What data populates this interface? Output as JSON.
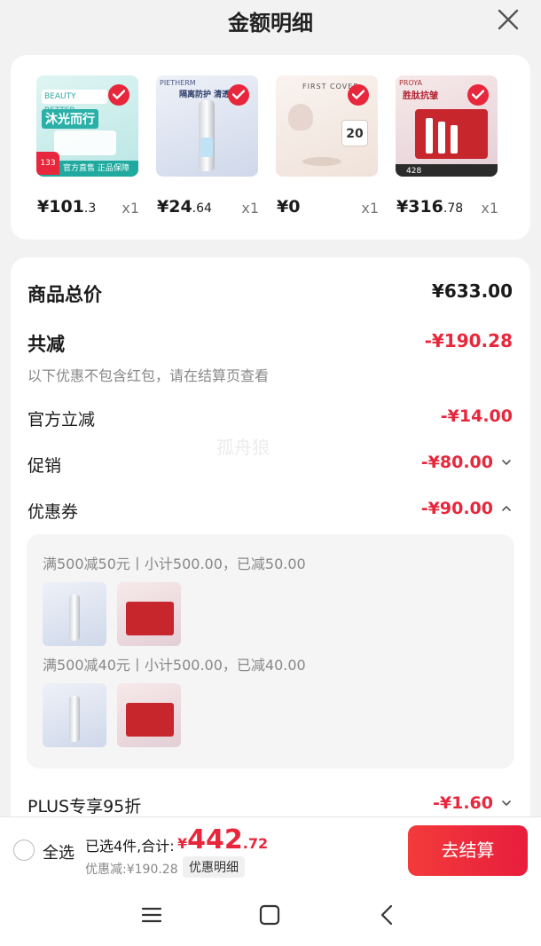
{
  "header": {
    "title": "金额明细",
    "close_icon": "close-icon"
  },
  "products": [
    {
      "price_int": "¥101",
      "price_dec": ".3",
      "qty": "x1",
      "thumb_text": "沐光而行",
      "thumb_brand": "BEAUTY BETTER",
      "thumb_tag": "官方直售 正品保障",
      "thumb_badge": "133",
      "thumb_bg": "#d9f2ef"
    },
    {
      "price_int": "¥24",
      "price_dec": ".64",
      "qty": "x1",
      "thumb_text": "隔离防护 清透底妆",
      "thumb_brand": "PIETHERM",
      "thumb_bg": "#e8ecf6"
    },
    {
      "price_int": "¥0",
      "price_dec": "",
      "qty": "x1",
      "thumb_text": "FIRST COVER",
      "thumb_badge": "20",
      "thumb_bg": "#f3ece8"
    },
    {
      "price_int": "¥316",
      "price_dec": ".78",
      "qty": "x1",
      "thumb_text": "胜肽抗皱",
      "thumb_brand": "PROYA",
      "thumb_badge": "428",
      "thumb_bg": "#f4dede"
    }
  ],
  "detail": {
    "total_label": "商品总价",
    "total_value": "¥633.00",
    "discount_label": "共减",
    "discount_value": "-¥190.28",
    "discount_note": "以下优惠不包含红包，请在结算页查看",
    "official_label": "官方立减",
    "official_value": "-¥14.00",
    "promo_label": "促销",
    "promo_value": "-¥80.00",
    "coupon_label": "优惠券",
    "coupon_value": "-¥90.00",
    "coupon_lines": [
      "满500减50元丨小计500.00，已减50.00",
      "满500减40元丨小计500.00，已减40.00"
    ],
    "plus_label": "PLUS专享95折",
    "plus_value": "-¥1.60"
  },
  "watermark": "孤舟狼",
  "bottom": {
    "select_all": "全选",
    "summary": "已选4件,合计:",
    "total_sym": "¥",
    "total_int": "442",
    "total_dec": ".72",
    "savings": "优惠减:¥190.28",
    "detail_tag": "优惠明细",
    "checkout": "去结算"
  },
  "colors": {
    "accent": "#e8273c",
    "background": "#f2f2f2"
  }
}
